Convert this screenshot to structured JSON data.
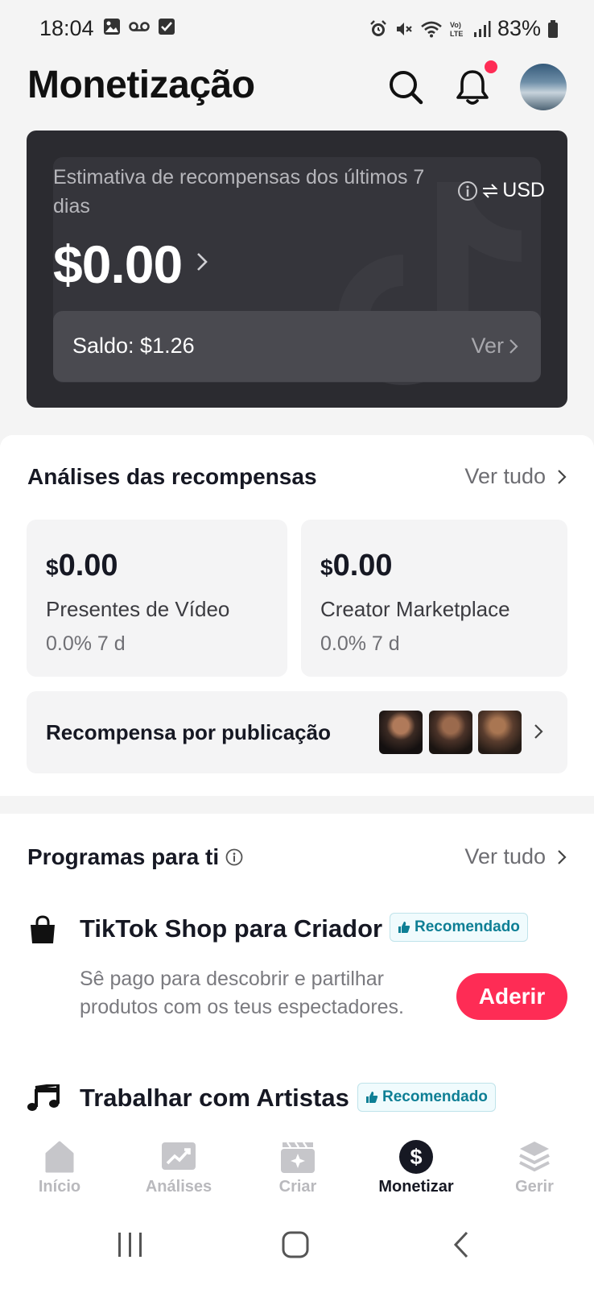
{
  "status_bar": {
    "time": "18:04",
    "battery": "83%"
  },
  "header": {
    "title": "Monetização"
  },
  "earnings": {
    "label": "Estimativa de recompensas dos últimos 7 dias",
    "currency": "USD",
    "amount": "$0.00",
    "balance": "Saldo: $1.26",
    "view_label": "Ver"
  },
  "analytics": {
    "title": "Análises das recompensas",
    "see_all": "Ver tudo",
    "cards": [
      {
        "currency_symbol": "$",
        "amount": "0.00",
        "label": "Presentes de Vídeo",
        "change": "0.0% 7 d"
      },
      {
        "currency_symbol": "$",
        "amount": "0.00",
        "label": "Creator Marketplace",
        "change": "0.0% 7 d"
      }
    ],
    "per_post_label": "Recompensa por publicação"
  },
  "programs": {
    "title": "Programas para ti",
    "see_all": "Ver tudo",
    "items": [
      {
        "title": "TikTok Shop para Criador",
        "badge": "Recomendado",
        "description": "Sê pago para descobrir e partilhar produtos com os teus espectadores.",
        "button": "Aderir",
        "icon": "shopping-bag-icon"
      },
      {
        "title": "Trabalhar com Artistas",
        "badge": "Recomendado",
        "icon": "music-note-icon"
      }
    ]
  },
  "bottom_nav": {
    "items": [
      {
        "label": "Início",
        "icon": "home-icon"
      },
      {
        "label": "Análises",
        "icon": "analytics-icon"
      },
      {
        "label": "Criar",
        "icon": "create-icon"
      },
      {
        "label": "Monetizar",
        "icon": "dollar-icon"
      },
      {
        "label": "Gerir",
        "icon": "layers-icon"
      }
    ],
    "active": "Monetizar"
  },
  "colors": {
    "accent": "#fe2c55",
    "badge_text": "#0e7f95",
    "card_dark": "#2b2b30"
  }
}
